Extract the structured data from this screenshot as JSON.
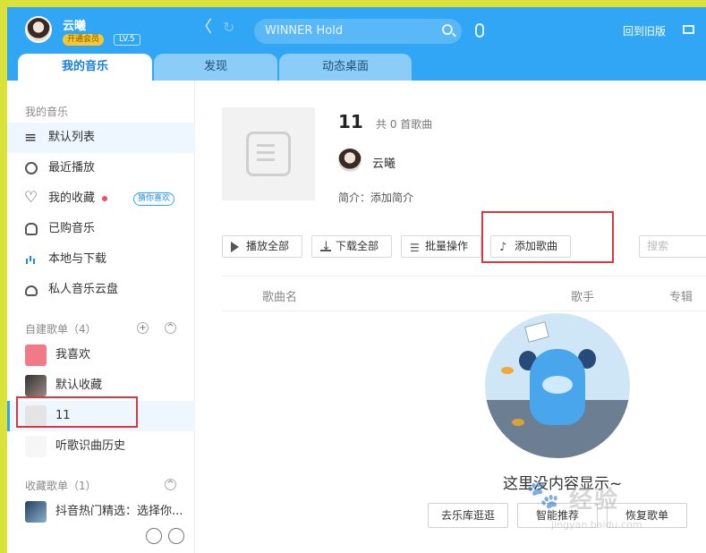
{
  "user": {
    "name": "云曦",
    "vip_label": "开通会员",
    "level": "LV.5"
  },
  "toolbar": {
    "search_value": "WINNER Hold",
    "old_version_label": "回到旧版",
    "back_glyph": "〈",
    "refresh_glyph": "↻"
  },
  "tabs": [
    {
      "label": "我的音乐"
    },
    {
      "label": "发现"
    },
    {
      "label": "动态桌面"
    }
  ],
  "sidebar": {
    "my_music_title": "我的音乐",
    "items": [
      {
        "label": "默认列表",
        "icon": "playlist-icon"
      },
      {
        "label": "最近播放",
        "icon": "clock-icon"
      },
      {
        "label": "我的收藏",
        "icon": "heart-icon",
        "tag": "猜你喜欢"
      },
      {
        "label": "已购音乐",
        "icon": "bag-icon"
      },
      {
        "label": "本地与下载",
        "icon": "bars-icon"
      },
      {
        "label": "私人音乐云盘",
        "icon": "cloud-icon"
      }
    ],
    "created_title": "自建歌单（4）",
    "created_lists": [
      {
        "label": "我喜欢",
        "icon": "heart-icon"
      },
      {
        "label": "默认收藏"
      },
      {
        "label": "11"
      },
      {
        "label": "听歌识曲历史"
      }
    ],
    "collected_title": "收藏歌单（1）",
    "collected_lists": [
      {
        "label": "抖音热门精选：选择你..."
      }
    ],
    "add_glyph": "+",
    "collapse_glyph": "^"
  },
  "playlist": {
    "title": "11",
    "count": "共 0 首歌曲",
    "owner": "云曦",
    "intro": "简介：添加简介"
  },
  "actions": {
    "play_all": "播放全部",
    "download_all": "下载全部",
    "batch": "批量操作",
    "add_song": "添加歌曲",
    "search_placeholder": "搜索"
  },
  "table": {
    "col_song": "歌曲名",
    "col_artist": "歌手",
    "col_album": "专辑"
  },
  "empty": {
    "text": "这里没内容显示~",
    "btn_browse": "去乐库逛逛",
    "btn_smart": "智能推荐",
    "btn_restore": "恢复歌单"
  },
  "watermark": {
    "text": "经验",
    "url": "jingyan.baidu.com"
  },
  "colors": {
    "accent": "#31a6f5",
    "highlight_box": "#d9383e",
    "tab_inactive": "#8cccf8"
  }
}
